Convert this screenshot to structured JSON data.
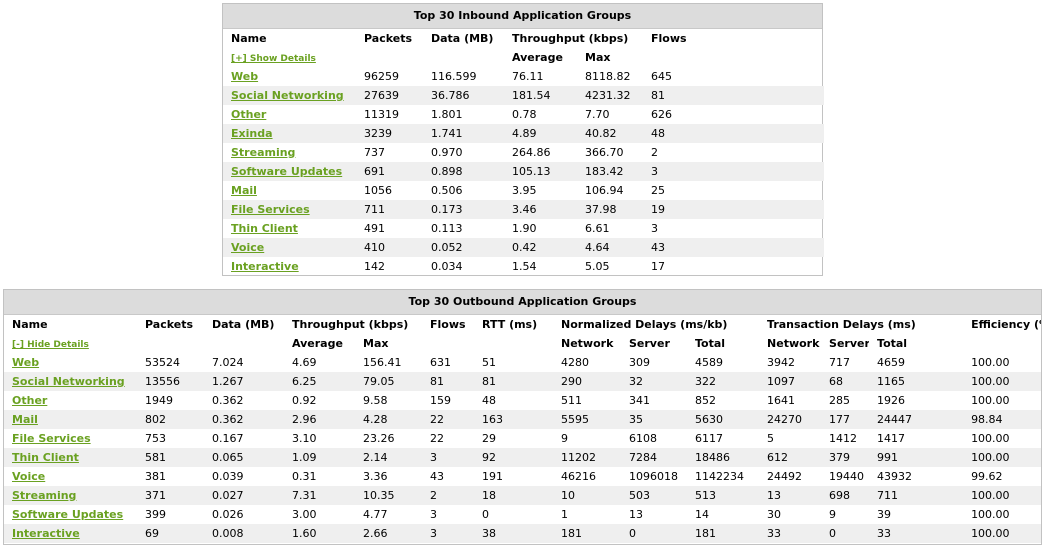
{
  "inbound": {
    "title": "Top 30 Inbound Application Groups",
    "headers": {
      "name": "Name",
      "packets": "Packets",
      "data": "Data (MB)",
      "throughput": "Throughput (kbps)",
      "flows": "Flows",
      "average": "Average",
      "max": "Max"
    },
    "toggle_label": "[+] Show Details",
    "rows": [
      {
        "name": "Web",
        "packets": "96259",
        "data": "116.599",
        "avg": "76.11",
        "max": "8118.82",
        "flows": "645"
      },
      {
        "name": "Social Networking",
        "packets": "27639",
        "data": "36.786",
        "avg": "181.54",
        "max": "4231.32",
        "flows": "81"
      },
      {
        "name": "Other",
        "packets": "11319",
        "data": "1.801",
        "avg": "0.78",
        "max": "7.70",
        "flows": "626"
      },
      {
        "name": "Exinda",
        "packets": "3239",
        "data": "1.741",
        "avg": "4.89",
        "max": "40.82",
        "flows": "48"
      },
      {
        "name": "Streaming",
        "packets": "737",
        "data": "0.970",
        "avg": "264.86",
        "max": "366.70",
        "flows": "2"
      },
      {
        "name": "Software Updates",
        "packets": "691",
        "data": "0.898",
        "avg": "105.13",
        "max": "183.42",
        "flows": "3"
      },
      {
        "name": "Mail",
        "packets": "1056",
        "data": "0.506",
        "avg": "3.95",
        "max": "106.94",
        "flows": "25"
      },
      {
        "name": "File Services",
        "packets": "711",
        "data": "0.173",
        "avg": "3.46",
        "max": "37.98",
        "flows": "19"
      },
      {
        "name": "Thin Client",
        "packets": "491",
        "data": "0.113",
        "avg": "1.90",
        "max": "6.61",
        "flows": "3"
      },
      {
        "name": "Voice",
        "packets": "410",
        "data": "0.052",
        "avg": "0.42",
        "max": "4.64",
        "flows": "43"
      },
      {
        "name": "Interactive",
        "packets": "142",
        "data": "0.034",
        "avg": "1.54",
        "max": "5.05",
        "flows": "17"
      }
    ]
  },
  "outbound": {
    "title": "Top 30 Outbound Application Groups",
    "headers": {
      "name": "Name",
      "packets": "Packets",
      "data": "Data (MB)",
      "throughput": "Throughput (kbps)",
      "flows": "Flows",
      "rtt": "RTT (ms)",
      "norm": "Normalized Delays (ms/kb)",
      "trans": "Transaction Delays (ms)",
      "efficiency": "Efficiency (%)",
      "average": "Average",
      "max": "Max",
      "network": "Network",
      "server": "Server",
      "total": "Total"
    },
    "toggle_label": "[-] Hide Details",
    "rows": [
      {
        "name": "Web",
        "packets": "53524",
        "data": "7.024",
        "avg": "4.69",
        "max": "156.41",
        "flows": "631",
        "rtt": "51",
        "nnet": "4280",
        "nsrv": "309",
        "ntot": "4589",
        "tnet": "3942",
        "tsrv": "717",
        "ttot": "4659",
        "eff": "100.00"
      },
      {
        "name": "Social Networking",
        "packets": "13556",
        "data": "1.267",
        "avg": "6.25",
        "max": "79.05",
        "flows": "81",
        "rtt": "81",
        "nnet": "290",
        "nsrv": "32",
        "ntot": "322",
        "tnet": "1097",
        "tsrv": "68",
        "ttot": "1165",
        "eff": "100.00"
      },
      {
        "name": "Other",
        "packets": "1949",
        "data": "0.362",
        "avg": "0.92",
        "max": "9.58",
        "flows": "159",
        "rtt": "48",
        "nnet": "511",
        "nsrv": "341",
        "ntot": "852",
        "tnet": "1641",
        "tsrv": "285",
        "ttot": "1926",
        "eff": "100.00"
      },
      {
        "name": "Mail",
        "packets": "802",
        "data": "0.362",
        "avg": "2.96",
        "max": "4.28",
        "flows": "22",
        "rtt": "163",
        "nnet": "5595",
        "nsrv": "35",
        "ntot": "5630",
        "tnet": "24270",
        "tsrv": "177",
        "ttot": "24447",
        "eff": "98.84"
      },
      {
        "name": "File Services",
        "packets": "753",
        "data": "0.167",
        "avg": "3.10",
        "max": "23.26",
        "flows": "22",
        "rtt": "29",
        "nnet": "9",
        "nsrv": "6108",
        "ntot": "6117",
        "tnet": "5",
        "tsrv": "1412",
        "ttot": "1417",
        "eff": "100.00"
      },
      {
        "name": "Thin Client",
        "packets": "581",
        "data": "0.065",
        "avg": "1.09",
        "max": "2.14",
        "flows": "3",
        "rtt": "92",
        "nnet": "11202",
        "nsrv": "7284",
        "ntot": "18486",
        "tnet": "612",
        "tsrv": "379",
        "ttot": "991",
        "eff": "100.00"
      },
      {
        "name": "Voice",
        "packets": "381",
        "data": "0.039",
        "avg": "0.31",
        "max": "3.36",
        "flows": "43",
        "rtt": "191",
        "nnet": "46216",
        "nsrv": "1096018",
        "ntot": "1142234",
        "tnet": "24492",
        "tsrv": "19440",
        "ttot": "43932",
        "eff": "99.62"
      },
      {
        "name": "Streaming",
        "packets": "371",
        "data": "0.027",
        "avg": "7.31",
        "max": "10.35",
        "flows": "2",
        "rtt": "18",
        "nnet": "10",
        "nsrv": "503",
        "ntot": "513",
        "tnet": "13",
        "tsrv": "698",
        "ttot": "711",
        "eff": "100.00"
      },
      {
        "name": "Software Updates",
        "packets": "399",
        "data": "0.026",
        "avg": "3.00",
        "max": "4.77",
        "flows": "3",
        "rtt": "0",
        "nnet": "1",
        "nsrv": "13",
        "ntot": "14",
        "tnet": "30",
        "tsrv": "9",
        "ttot": "39",
        "eff": "100.00"
      },
      {
        "name": "Interactive",
        "packets": "69",
        "data": "0.008",
        "avg": "1.60",
        "max": "2.66",
        "flows": "3",
        "rtt": "38",
        "nnet": "181",
        "nsrv": "0",
        "ntot": "181",
        "tnet": "33",
        "tsrv": "0",
        "ttot": "33",
        "eff": "100.00"
      }
    ]
  }
}
